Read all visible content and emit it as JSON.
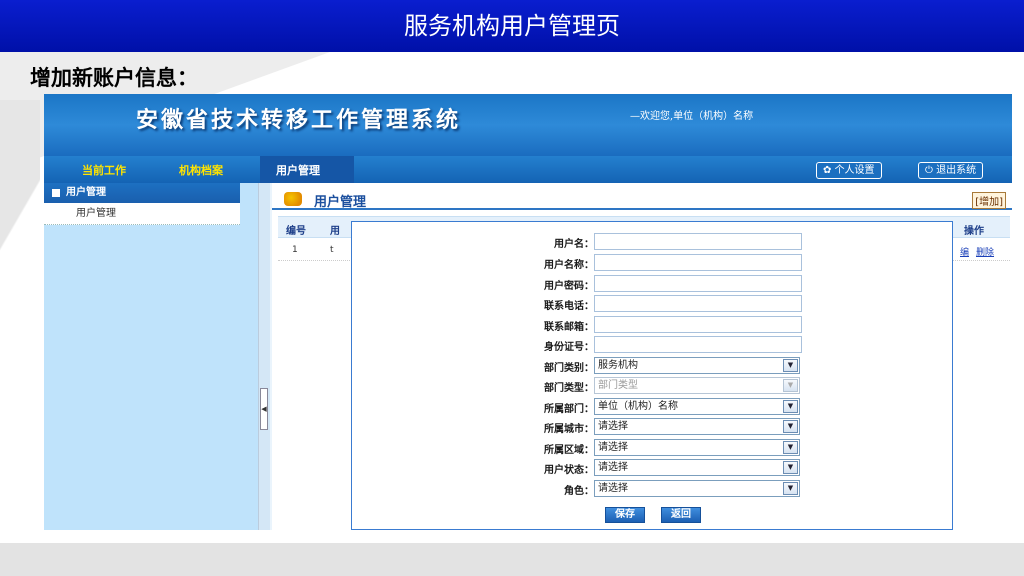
{
  "slide": {
    "title": "服务机构用户管理页",
    "subtitle": "增加新账户信息："
  },
  "app": {
    "system_title": "安徽省技术转移工作管理系统",
    "welcome_text": "—欢迎您,单位（机构）名称",
    "nav": [
      {
        "label": "当前工作"
      },
      {
        "label": "机构档案"
      },
      {
        "label": "用户管理"
      }
    ],
    "personal_settings": "个人设置",
    "logout": "退出系统",
    "sidebar": {
      "header": "用户管理",
      "items": [
        {
          "label": "用户管理"
        }
      ]
    },
    "content": {
      "title": "用户管理",
      "add_link": "[增加]",
      "columns": {
        "id": "编号",
        "username": "用",
        "ops": "操作"
      },
      "rows": [
        {
          "id": "1",
          "username": "t",
          "op_edit": "编",
          "op_delete": "删除"
        }
      ]
    }
  },
  "form": {
    "fields": {
      "username": {
        "label": "用户名："
      },
      "name": {
        "label": "用户名称："
      },
      "password": {
        "label": "用户密码："
      },
      "phone": {
        "label": "联系电话："
      },
      "email": {
        "label": "联系邮箱："
      },
      "idcard": {
        "label": "身份证号："
      },
      "dept_category": {
        "label": "部门类别：",
        "value": "服务机构"
      },
      "dept_type": {
        "label": "部门类型：",
        "value": "部门类型"
      },
      "dept": {
        "label": "所属部门：",
        "value": "单位（机构）名称"
      },
      "city": {
        "label": "所属城市：",
        "value": "请选择"
      },
      "region": {
        "label": "所属区域：",
        "value": "请选择"
      },
      "status": {
        "label": "用户状态：",
        "value": "请选择"
      },
      "role": {
        "label": "角色：",
        "value": "请选择"
      }
    },
    "save_label": "保存",
    "back_label": "返回"
  },
  "colors": {
    "header_blue": "#0a1ecf",
    "banner_blue": "#2e8ad8",
    "nav_yellow": "#ffe400",
    "sidebar_bg": "#bfe3fb"
  }
}
